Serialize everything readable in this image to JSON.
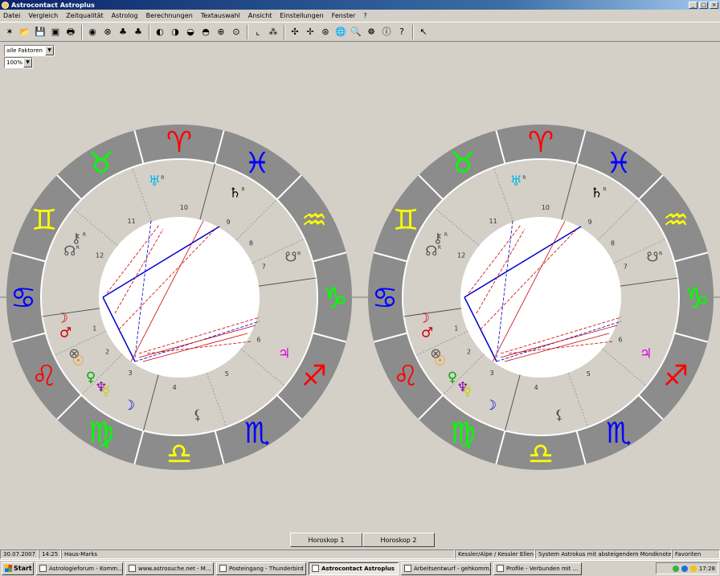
{
  "window": {
    "title": "Astrocontact Astroplus",
    "controls": [
      "_",
      "□",
      "×"
    ]
  },
  "menu": [
    "Datei",
    "Vergleich",
    "Zeitqualität",
    "Astrolog",
    "Berechnungen",
    "Textauswahl",
    "Ansicht",
    "Einstellungen",
    "Fenster",
    "?"
  ],
  "toolbar": {
    "icons": [
      {
        "name": "new-icon",
        "glyph": "✶"
      },
      {
        "name": "open-icon",
        "glyph": "📂"
      },
      {
        "name": "save-icon",
        "glyph": "💾"
      },
      {
        "name": "print-preview-icon",
        "glyph": "▣"
      },
      {
        "name": "print-icon",
        "glyph": "🖶"
      },
      {
        "name": "sep",
        "glyph": ""
      },
      {
        "name": "radix-icon",
        "glyph": "◉"
      },
      {
        "name": "synastry-icon",
        "glyph": "⊗"
      },
      {
        "name": "composite-icon",
        "glyph": "♣"
      },
      {
        "name": "combin-icon",
        "glyph": "♣"
      },
      {
        "name": "sep",
        "glyph": ""
      },
      {
        "name": "transit-icon",
        "glyph": "◐"
      },
      {
        "name": "solar-icon",
        "glyph": "◑"
      },
      {
        "name": "lunar-icon",
        "glyph": "◒"
      },
      {
        "name": "progression-icon",
        "glyph": "◓"
      },
      {
        "name": "direction-icon",
        "glyph": "⊕"
      },
      {
        "name": "profection-icon",
        "glyph": "⊙"
      },
      {
        "name": "sep",
        "glyph": ""
      },
      {
        "name": "diagram-icon",
        "glyph": "⌞"
      },
      {
        "name": "aspect-grid-icon",
        "glyph": "⁂"
      },
      {
        "name": "sep",
        "glyph": ""
      },
      {
        "name": "dial-icon",
        "glyph": "✣"
      },
      {
        "name": "midpoint-icon",
        "glyph": "✢"
      },
      {
        "name": "mundane-icon",
        "glyph": "⊛"
      },
      {
        "name": "globe-icon",
        "glyph": "🌐"
      },
      {
        "name": "search-icon",
        "glyph": "🔍"
      },
      {
        "name": "ephemeris-icon",
        "glyph": "☸"
      },
      {
        "name": "info-icon",
        "glyph": "ⓘ"
      },
      {
        "name": "help-icon",
        "glyph": "?"
      },
      {
        "name": "sep",
        "glyph": ""
      },
      {
        "name": "context-help-icon",
        "glyph": "↖"
      }
    ]
  },
  "view_select": {
    "value": "alle Faktoren"
  },
  "zoom_select": {
    "value": "100%"
  },
  "colors": {
    "ring": "#8c8c8c",
    "fire": "#ff0000",
    "earth": "#00ff00",
    "air": "#ffff00",
    "water": "#0000ff",
    "blue_aspect": "#0000cc",
    "red_aspect": "#cc0000"
  },
  "charts": [
    {
      "signs": [
        {
          "symbol": "♈",
          "color": "fire"
        },
        {
          "symbol": "♓",
          "color": "water"
        },
        {
          "symbol": "♒",
          "color": "air"
        },
        {
          "symbol": "♑",
          "color": "earth"
        },
        {
          "symbol": "♐",
          "color": "fire"
        },
        {
          "symbol": "♏",
          "color": "water"
        },
        {
          "symbol": "♎",
          "color": "air"
        },
        {
          "symbol": "♍",
          "color": "earth"
        },
        {
          "symbol": "♌",
          "color": "fire"
        },
        {
          "symbol": "♋",
          "color": "water"
        },
        {
          "symbol": "♊",
          "color": "air"
        },
        {
          "symbol": "♉",
          "color": "earth"
        }
      ],
      "house_numbers": [
        "1",
        "2",
        "3",
        "4",
        "5",
        "6",
        "7",
        "8",
        "9",
        "10",
        "11",
        "12"
      ],
      "planets": [
        {
          "symbol": "♅",
          "suffix": "R",
          "color": "#00b8e0"
        },
        {
          "symbol": "♄",
          "suffix": "R",
          "color": "#000000"
        },
        {
          "symbol": "⚷",
          "suffix": "R",
          "color": "#555555"
        },
        {
          "symbol": "☊",
          "suffix": "R",
          "color": "#555555"
        },
        {
          "symbol": "☽",
          "suffix": "",
          "color": "#cc0000"
        },
        {
          "symbol": "♂",
          "suffix": "",
          "color": "#cc0000"
        },
        {
          "symbol": "⊗",
          "suffix": "",
          "color": "#555555"
        },
        {
          "symbol": "☉",
          "suffix": "",
          "color": "#ff8800"
        },
        {
          "symbol": "♀",
          "suffix": "",
          "color": "#00aa00"
        },
        {
          "symbol": "♆",
          "suffix": "",
          "color": "#8800aa"
        },
        {
          "symbol": "☿",
          "suffix": "",
          "color": "#cccc00"
        },
        {
          "symbol": "☽",
          "suffix": "",
          "color": "#0000cc"
        },
        {
          "symbol": "♃",
          "suffix": "",
          "color": "#dd00dd"
        },
        {
          "symbol": "☋",
          "suffix": "R",
          "color": "#555555"
        },
        {
          "symbol": "⚸",
          "suffix": "",
          "color": "#555555"
        }
      ]
    },
    {
      "signs": [
        {
          "symbol": "♈",
          "color": "fire"
        },
        {
          "symbol": "♓",
          "color": "water"
        },
        {
          "symbol": "♒",
          "color": "air"
        },
        {
          "symbol": "♑",
          "color": "earth"
        },
        {
          "symbol": "♐",
          "color": "fire"
        },
        {
          "symbol": "♏",
          "color": "water"
        },
        {
          "symbol": "♎",
          "color": "air"
        },
        {
          "symbol": "♍",
          "color": "earth"
        },
        {
          "symbol": "♌",
          "color": "fire"
        },
        {
          "symbol": "♋",
          "color": "water"
        },
        {
          "symbol": "♊",
          "color": "air"
        },
        {
          "symbol": "♉",
          "color": "earth"
        }
      ],
      "house_numbers": [
        "1",
        "2",
        "3",
        "4",
        "5",
        "6",
        "7",
        "8",
        "9",
        "10",
        "11",
        "12"
      ],
      "planets": [
        {
          "symbol": "♅",
          "suffix": "R",
          "color": "#00b8e0"
        },
        {
          "symbol": "♄",
          "suffix": "R",
          "color": "#000000"
        },
        {
          "symbol": "⚷",
          "suffix": "R",
          "color": "#555555"
        },
        {
          "symbol": "☊",
          "suffix": "R",
          "color": "#555555"
        },
        {
          "symbol": "☽",
          "suffix": "",
          "color": "#cc0000"
        },
        {
          "symbol": "♂",
          "suffix": "",
          "color": "#cc0000"
        },
        {
          "symbol": "⊗",
          "suffix": "",
          "color": "#555555"
        },
        {
          "symbol": "☉",
          "suffix": "",
          "color": "#ff8800"
        },
        {
          "symbol": "♀",
          "suffix": "",
          "color": "#00aa00"
        },
        {
          "symbol": "♆",
          "suffix": "",
          "color": "#8800aa"
        },
        {
          "symbol": "☿",
          "suffix": "",
          "color": "#cccc00"
        },
        {
          "symbol": "☽",
          "suffix": "",
          "color": "#0000cc"
        },
        {
          "symbol": "♃",
          "suffix": "",
          "color": "#dd00dd"
        },
        {
          "symbol": "☋",
          "suffix": "R",
          "color": "#555555"
        },
        {
          "symbol": "⚸",
          "suffix": "",
          "color": "#555555"
        }
      ]
    }
  ],
  "tabs": [
    "Horoskop 1",
    "Horoskop 2"
  ],
  "status": [
    "30.07.2007",
    "14:25",
    "Haus-Marks",
    "Kessler/Alpe / Kessler Ellen",
    "System Astrokus mit absteigendem Mondknoten",
    "Favoriten"
  ],
  "taskbar": {
    "start_label": "Start",
    "tasks": [
      {
        "label": "Astrologieforum - Komm...",
        "active": false
      },
      {
        "label": "www.astrosuche.net - M...",
        "active": false
      },
      {
        "label": "Posteingang - Thunderbird",
        "active": false
      },
      {
        "label": "Astrocontact Astroplus",
        "active": true
      },
      {
        "label": "Arbeitsentwurf - gehkomm...",
        "active": false
      },
      {
        "label": "Profile - Verbunden mit ...",
        "active": false
      }
    ],
    "clock": "17:28"
  }
}
